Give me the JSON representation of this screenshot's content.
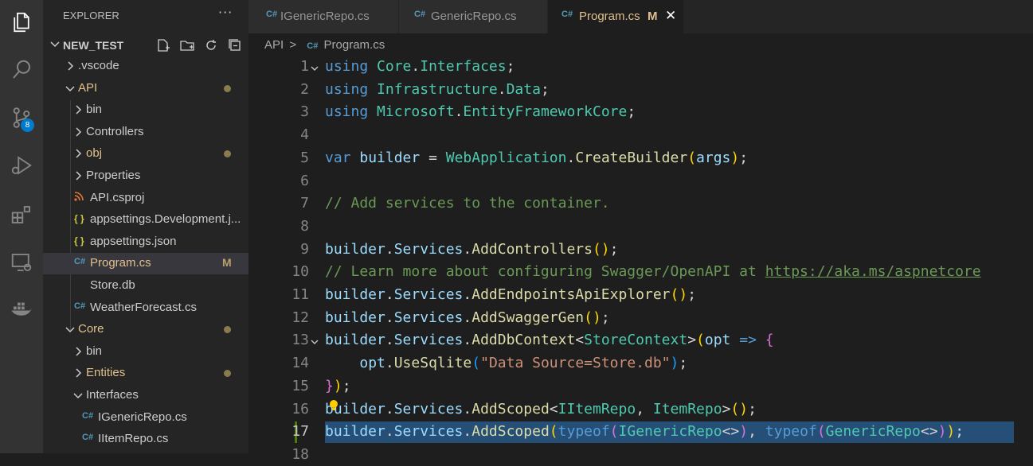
{
  "explorer": {
    "title": "EXPLORER",
    "more": "···",
    "project": "NEW_TEST",
    "items": [
      {
        "label": ".vscode",
        "depth": 0,
        "kind": "folder-closed"
      },
      {
        "label": "API",
        "depth": 0,
        "kind": "folder-open",
        "status": "dot",
        "color": "#e2c08d"
      },
      {
        "label": "bin",
        "depth": 1,
        "kind": "folder-closed"
      },
      {
        "label": "Controllers",
        "depth": 1,
        "kind": "folder-closed"
      },
      {
        "label": "obj",
        "depth": 1,
        "kind": "folder-closed",
        "status": "dot",
        "color": "#e2c08d"
      },
      {
        "label": "Properties",
        "depth": 1,
        "kind": "folder-closed"
      },
      {
        "label": "API.csproj",
        "depth": 1,
        "kind": "rss"
      },
      {
        "label": "appsettings.Development.j...",
        "depth": 1,
        "kind": "json"
      },
      {
        "label": "appsettings.json",
        "depth": 1,
        "kind": "json"
      },
      {
        "label": "Program.cs",
        "depth": 1,
        "kind": "cs",
        "status": "M",
        "color": "#e2c08d",
        "selected": true
      },
      {
        "label": "Store.db",
        "depth": 1,
        "kind": "db"
      },
      {
        "label": "WeatherForecast.cs",
        "depth": 1,
        "kind": "cs"
      },
      {
        "label": "Core",
        "depth": 0,
        "kind": "folder-open",
        "status": "dot",
        "color": "#e2c08d"
      },
      {
        "label": "bin",
        "depth": 1,
        "kind": "folder-closed"
      },
      {
        "label": "Entities",
        "depth": 1,
        "kind": "folder-closed",
        "status": "dot",
        "color": "#e2c08d"
      },
      {
        "label": "Interfaces",
        "depth": 1,
        "kind": "folder-open"
      },
      {
        "label": "IGenericRepo.cs",
        "depth": 2,
        "kind": "cs"
      },
      {
        "label": "IItemRepo.cs",
        "depth": 2,
        "kind": "cs"
      }
    ]
  },
  "source_control_badge": "8",
  "tabs": [
    {
      "label": "IGenericRepo.cs",
      "active": false
    },
    {
      "label": "GenericRepo.cs",
      "active": false
    },
    {
      "label": "Program.cs",
      "active": true,
      "modified": "M",
      "close": "✕"
    }
  ],
  "breadcrumb": {
    "folder": "API",
    "sep": ">",
    "file": "Program.cs",
    "file_icon": "C#"
  },
  "icons": {
    "csharp": "C#",
    "json": "{ }"
  },
  "editor": {
    "active_line": 17,
    "lines": [
      {
        "n": "1",
        "fold": true,
        "html": "<span class='k'>using</span> <span class='t'>Core</span><span class='p'>.</span><span class='t'>Interfaces</span><span class='p'>;</span>"
      },
      {
        "n": "2",
        "html": "<span class='k'>using</span> <span class='t'>Infrastructure</span><span class='p'>.</span><span class='t'>Data</span><span class='p'>;</span>"
      },
      {
        "n": "3",
        "html": "<span class='k'>using</span> <span class='t'>Microsoft</span><span class='p'>.</span><span class='t'>EntityFrameworkCore</span><span class='p'>;</span>"
      },
      {
        "n": "4",
        "html": ""
      },
      {
        "n": "5",
        "html": "<span class='k'>var</span> <span class='v'>builder</span> <span class='p'>=</span> <span class='t'>WebApplication</span><span class='p'>.</span><span class='f'>CreateBuilder</span><span class='b1'>(</span><span class='v'>args</span><span class='b1'>)</span><span class='p'>;</span>"
      },
      {
        "n": "6",
        "html": ""
      },
      {
        "n": "7",
        "html": "<span class='c'>// Add services to the container.</span>"
      },
      {
        "n": "8",
        "html": ""
      },
      {
        "n": "9",
        "html": "<span class='v'>builder</span><span class='p'>.</span><span class='v'>Services</span><span class='p'>.</span><span class='f'>AddControllers</span><span class='b1'>()</span><span class='p'>;</span>"
      },
      {
        "n": "10",
        "html": "<span class='c'>// Learn more about configuring Swagger/OpenAPI at </span><span class='link'>https://aka.ms/aspnetcore</span>"
      },
      {
        "n": "11",
        "html": "<span class='v'>builder</span><span class='p'>.</span><span class='v'>Services</span><span class='p'>.</span><span class='f'>AddEndpointsApiExplorer</span><span class='b1'>()</span><span class='p'>;</span>"
      },
      {
        "n": "12",
        "html": "<span class='v'>builder</span><span class='p'>.</span><span class='v'>Services</span><span class='p'>.</span><span class='f'>AddSwaggerGen</span><span class='b1'>()</span><span class='p'>;</span>"
      },
      {
        "n": "13",
        "fold": true,
        "html": "<span class='v'>builder</span><span class='p'>.</span><span class='v'>Services</span><span class='p'>.</span><span class='f'>AddDbContext</span><span class='p'>&lt;</span><span class='t'>StoreContext</span><span class='p'>&gt;</span><span class='b1'>(</span><span class='v'>opt</span> <span class='k'>=&gt;</span> <span class='b2'>{</span>"
      },
      {
        "n": "14",
        "html": "    <span class='v'>opt</span><span class='p'>.</span><span class='f'>UseSqlite</span><span class='b3'>(</span><span class='s'>\"Data Source=Store.db\"</span><span class='b3'>)</span><span class='p'>;</span>"
      },
      {
        "n": "15",
        "html": "<span class='b2'>}</span><span class='b1'>)</span><span class='p'>;</span>"
      },
      {
        "n": "16",
        "html": "<span class='v'>builder</span><span class='p'>.</span><span class='v'>Services</span><span class='p'>.</span><span class='f'>AddScoped</span><span class='p'>&lt;</span><span class='t'>IItemRepo</span><span class='p'>, </span><span class='t'>ItemRepo</span><span class='p'>&gt;</span><span class='b1'>()</span><span class='p'>;</span>"
      },
      {
        "n": "17",
        "selected": true,
        "html": "<span class='v'>builder</span><span class='p'>.</span><span class='v'>Services</span><span class='p'>.</span><span class='f'>AddScoped</span><span class='b1'>(</span><span class='k'>typeof</span><span class='b2'>(</span><span class='t'>IGenericRepo</span><span class='p'>&lt;&gt;</span><span class='b2'>)</span><span class='p'>, </span><span class='k'>typeof</span><span class='b2'>(</span><span class='t'>GenericRepo</span><span class='p'>&lt;&gt;</span><span class='b2'>)</span><span class='b1'>)</span><span class='p'>;</span>"
      },
      {
        "n": "18",
        "html": ""
      }
    ]
  }
}
